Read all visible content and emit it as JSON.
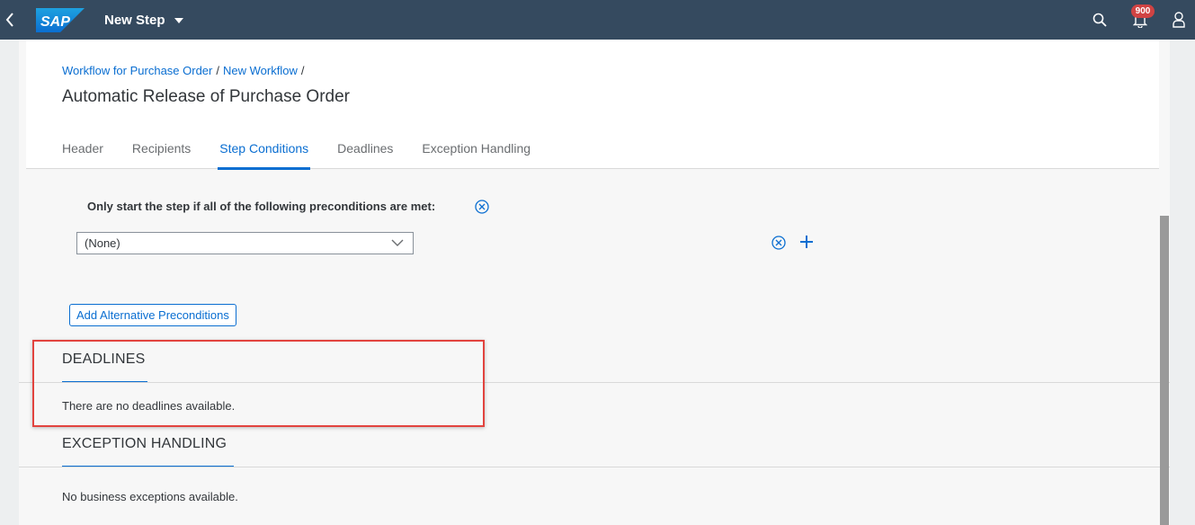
{
  "shell": {
    "app_title": "New Step",
    "logo_text": "SAP",
    "notification_count": "900",
    "icons": [
      "back-icon",
      "search-icon",
      "bell-icon",
      "user-icon"
    ]
  },
  "header": {
    "breadcrumb": [
      "Workflow for Purchase Order",
      "New Workflow"
    ],
    "breadcrumb_separator": "/",
    "title": "Automatic Release of Purchase Order",
    "tabs": [
      "Header",
      "Recipients",
      "Step Conditions",
      "Deadlines",
      "Exception Handling"
    ],
    "active_tab": "Step Conditions"
  },
  "step_conditions": {
    "precondition_label": "Only start the step if all of the following preconditions are met:",
    "select_value": "(None)",
    "add_alternative_label": "Add Alternative Preconditions"
  },
  "deadlines": {
    "title": "DEADLINES",
    "empty_text": "There are no deadlines available."
  },
  "exception_handling": {
    "title": "EXCEPTION HANDLING",
    "empty_text": "No business exceptions available."
  },
  "colors": {
    "shell_bg": "#354a5f",
    "accent": "#0a6ed1",
    "badge": "#d04343",
    "highlight_border": "#e2443f"
  }
}
